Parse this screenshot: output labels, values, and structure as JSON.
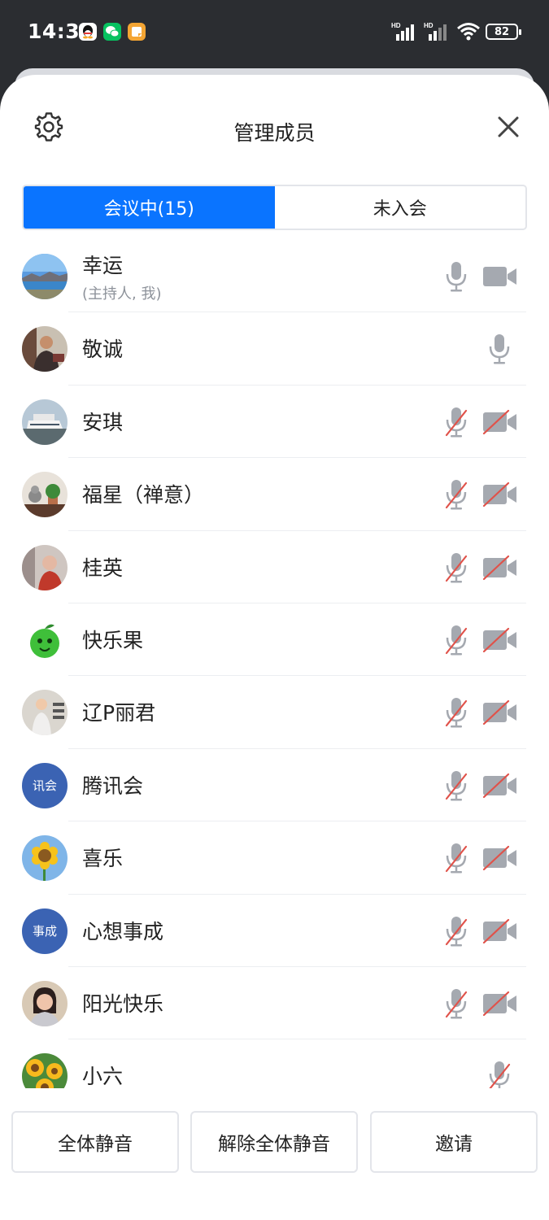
{
  "status_bar": {
    "time": "14:34",
    "signal_label_1": "HD",
    "signal_label_2": "HD",
    "battery": "82",
    "app_icons": [
      "qq-icon",
      "wechat-icon",
      "notes-icon"
    ]
  },
  "header": {
    "title": "管理成员"
  },
  "tabs": [
    {
      "label": "会议中(15)",
      "active": true
    },
    {
      "label": "未入会",
      "active": false
    }
  ],
  "members": [
    {
      "name": "幸运",
      "sub": "(主持人, 我)",
      "avatar": "photo-lake",
      "mic": "on",
      "cam": "on"
    },
    {
      "name": "敬诚",
      "sub": "",
      "avatar": "photo-man",
      "mic": "on",
      "cam": "none"
    },
    {
      "name": "安琪",
      "sub": "",
      "avatar": "photo-ship",
      "mic": "off",
      "cam": "off"
    },
    {
      "name": "福星（禅意）",
      "sub": "",
      "avatar": "photo-cat-plant",
      "mic": "off",
      "cam": "off"
    },
    {
      "name": "桂英",
      "sub": "",
      "avatar": "photo-woman-red",
      "mic": "off",
      "cam": "off"
    },
    {
      "name": "快乐果",
      "sub": "",
      "avatar": "green-apple",
      "mic": "off",
      "cam": "off"
    },
    {
      "name": "辽P丽君",
      "sub": "",
      "avatar": "photo-girl",
      "mic": "off",
      "cam": "off"
    },
    {
      "name": "腾讯会",
      "sub": "",
      "avatar": "text",
      "avatar_text": "讯会",
      "mic": "off",
      "cam": "off"
    },
    {
      "name": "喜乐",
      "sub": "",
      "avatar": "sunflower",
      "mic": "off",
      "cam": "off"
    },
    {
      "name": "心想事成",
      "sub": "",
      "avatar": "text",
      "avatar_text": "事成",
      "mic": "off",
      "cam": "off"
    },
    {
      "name": "阳光快乐",
      "sub": "",
      "avatar": "photo-woman",
      "mic": "off",
      "cam": "off"
    },
    {
      "name": "小六",
      "sub": "",
      "avatar": "sunflowers",
      "mic": "off",
      "cam": "none"
    }
  ],
  "actions": {
    "mute_all": "全体静音",
    "unmute_all": "解除全体静音",
    "invite": "邀请"
  },
  "colors": {
    "accent": "#0a74ff",
    "avatar_text_bg": "#3b63b3",
    "muted_slash": "#e0524a",
    "icon_gray": "#a5a9b0"
  }
}
